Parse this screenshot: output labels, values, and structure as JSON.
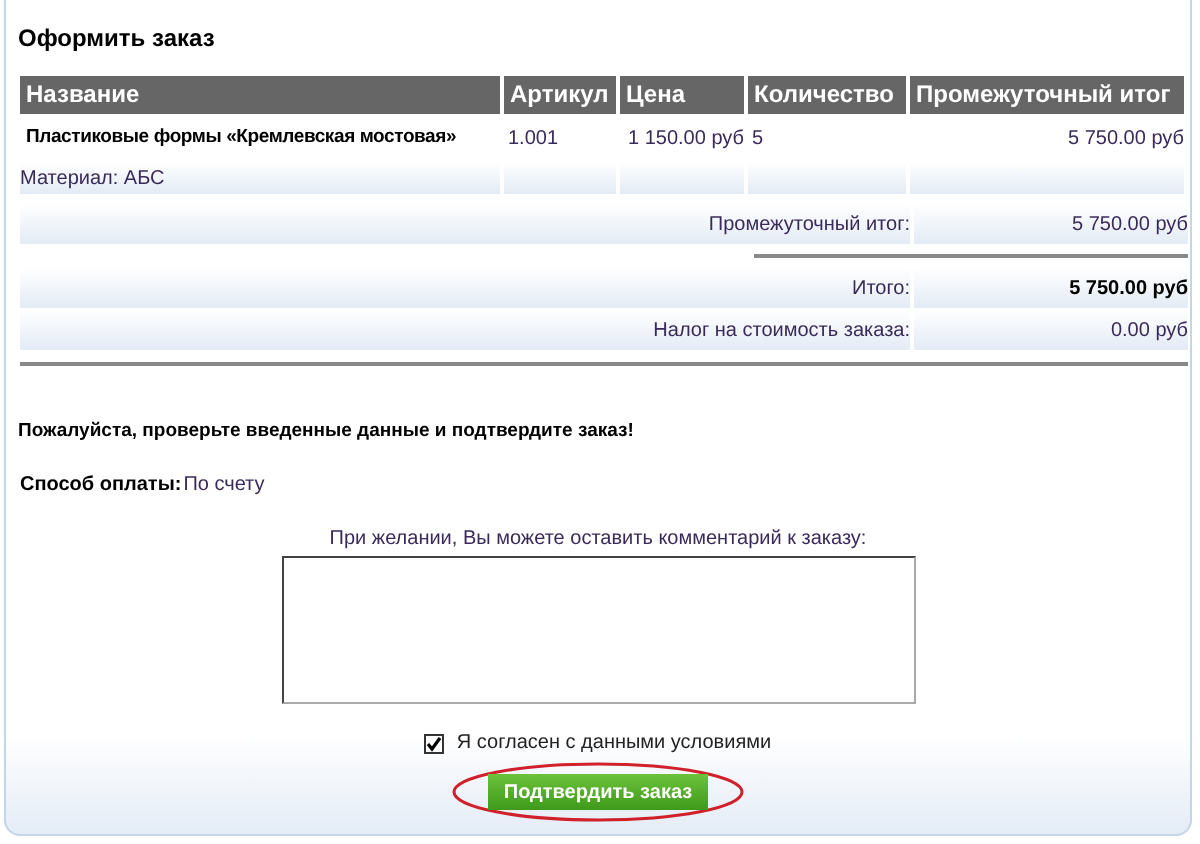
{
  "title": "Оформить заказ",
  "table": {
    "columns": [
      "Название",
      "Артикул",
      "Цена",
      "Количество",
      "Промежуточный итог"
    ],
    "rows": [
      {
        "name": "Пластиковые формы «Кремлевская мостовая»",
        "sku": "1.001",
        "price": "1 150.00 руб",
        "quantity": "5",
        "subtotal": "5 750.00 руб",
        "option": "Материал: АБС"
      }
    ]
  },
  "totals": [
    {
      "label": "Промежуточный итог:",
      "value": "5 750.00 руб",
      "bold": false,
      "rule_above": false
    },
    {
      "label": "Итого:",
      "value": "5 750.00 руб",
      "bold": true,
      "rule_above": true
    },
    {
      "label": "Налог на стоимость заказа:",
      "value": "0.00 руб",
      "bold": false,
      "rule_above": false
    }
  ],
  "message": "Пожалуйста, проверьте введенные данные и подтвердите заказ!",
  "payment": {
    "label": "Способ оплаты:",
    "value": "По счету"
  },
  "comment": {
    "label": "При желании, Вы можете оставить комментарий к заказу:"
  },
  "agree": {
    "label": "Я согласен с данными условиями",
    "checked": true
  },
  "confirm_button": "Подтвердить заказ"
}
